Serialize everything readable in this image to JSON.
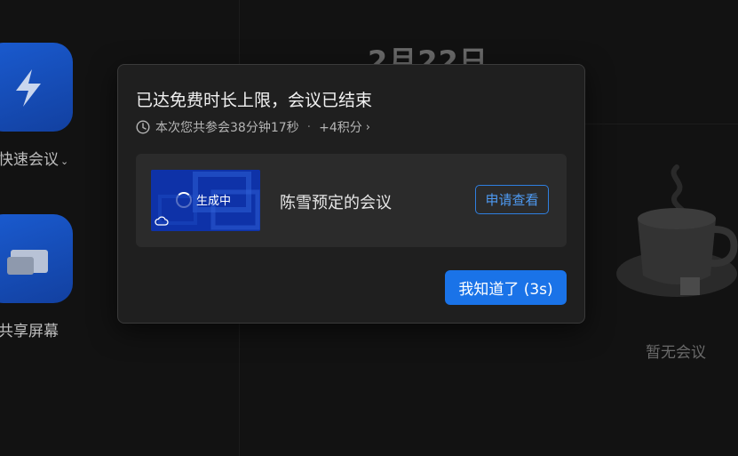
{
  "sidebar": {
    "quick_meeting": {
      "label": "快速会议",
      "icon": "lightning-icon"
    },
    "share_screen": {
      "label": "共享屏幕",
      "icon": "screens-icon"
    }
  },
  "main": {
    "date": "2月22日",
    "empty_state": {
      "text": "暂无会议",
      "icon": "coffee-cup-icon"
    }
  },
  "dialog": {
    "title": "已达免费时长上限，会议已结束",
    "duration_text": "本次您共参会38分钟17秒",
    "separator": "·",
    "points": "+4积分",
    "recording": {
      "status": "生成中",
      "meeting_name": "陈雪预定的会议",
      "apply_label": "申请查看"
    },
    "ok_label": "我知道了 (3s)"
  },
  "colors": {
    "accent": "#1a73e8",
    "outline_button": "#2f7fe0",
    "tile_blue": "#1a5bd0",
    "dialog_bg": "#1f1f1f",
    "page_bg": "#121212"
  }
}
